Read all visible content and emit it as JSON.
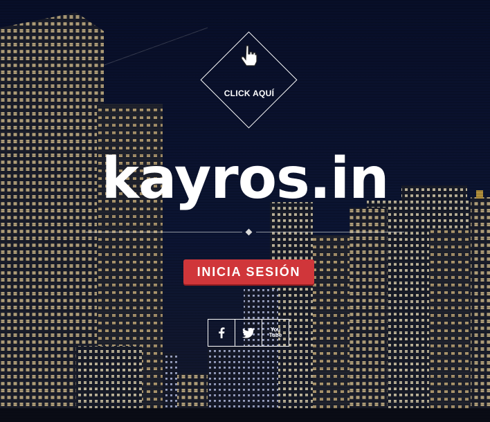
{
  "hero": {
    "click_label": "CLICK AQUÍ",
    "logo_text": "kayros.in",
    "login_label": "INICIA SESIÓN"
  },
  "social": {
    "facebook_icon": "facebook-icon",
    "twitter_icon": "twitter-icon",
    "youtube_text_top": "You",
    "youtube_text_bottom": "Tube"
  },
  "colors": {
    "sky": "#0b1026",
    "accent": "#d0363a",
    "text": "#ffffff"
  }
}
